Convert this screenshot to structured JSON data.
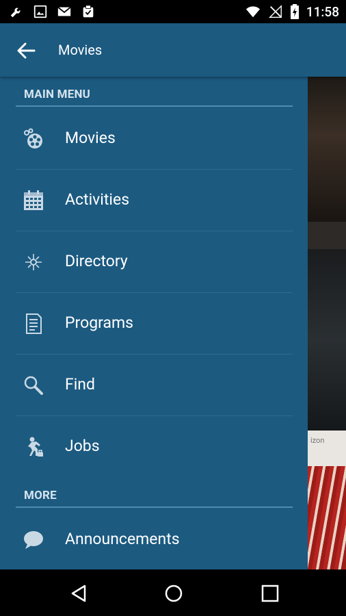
{
  "status_bar": {
    "time": "11:58",
    "left_icons": [
      "wrench-icon",
      "image-icon",
      "gmail-icon",
      "clipboard-check-icon"
    ],
    "right_icons": [
      "wifi-icon",
      "no-signal-icon",
      "battery-charging-icon"
    ]
  },
  "app_bar": {
    "title": "Movies",
    "back_icon": "arrow-back-icon"
  },
  "drawer": {
    "sections": [
      {
        "header": "MAIN MENU"
      },
      {
        "header": "MORE"
      }
    ],
    "main_items": [
      {
        "label": "Movies",
        "icon": "film-reel-icon"
      },
      {
        "label": "Activities",
        "icon": "calendar-icon"
      },
      {
        "label": "Directory",
        "icon": "compass-icon"
      },
      {
        "label": "Programs",
        "icon": "document-icon"
      },
      {
        "label": "Find",
        "icon": "search-icon"
      },
      {
        "label": "Jobs",
        "icon": "worker-icon"
      }
    ],
    "more_items": [
      {
        "label": "Announcements",
        "icon": "speech-bubble-icon"
      }
    ]
  },
  "background": {
    "caption_fragment": "izon"
  },
  "nav_bar": {
    "buttons": [
      "back-triangle-icon",
      "home-circle-icon",
      "recents-square-icon"
    ]
  },
  "colors": {
    "primary": "#1c5a80",
    "divider": "#2f6c91",
    "section_underline": "#4f8db0",
    "header_text": "#d6e4ee",
    "icon": "#c9d9e4"
  }
}
